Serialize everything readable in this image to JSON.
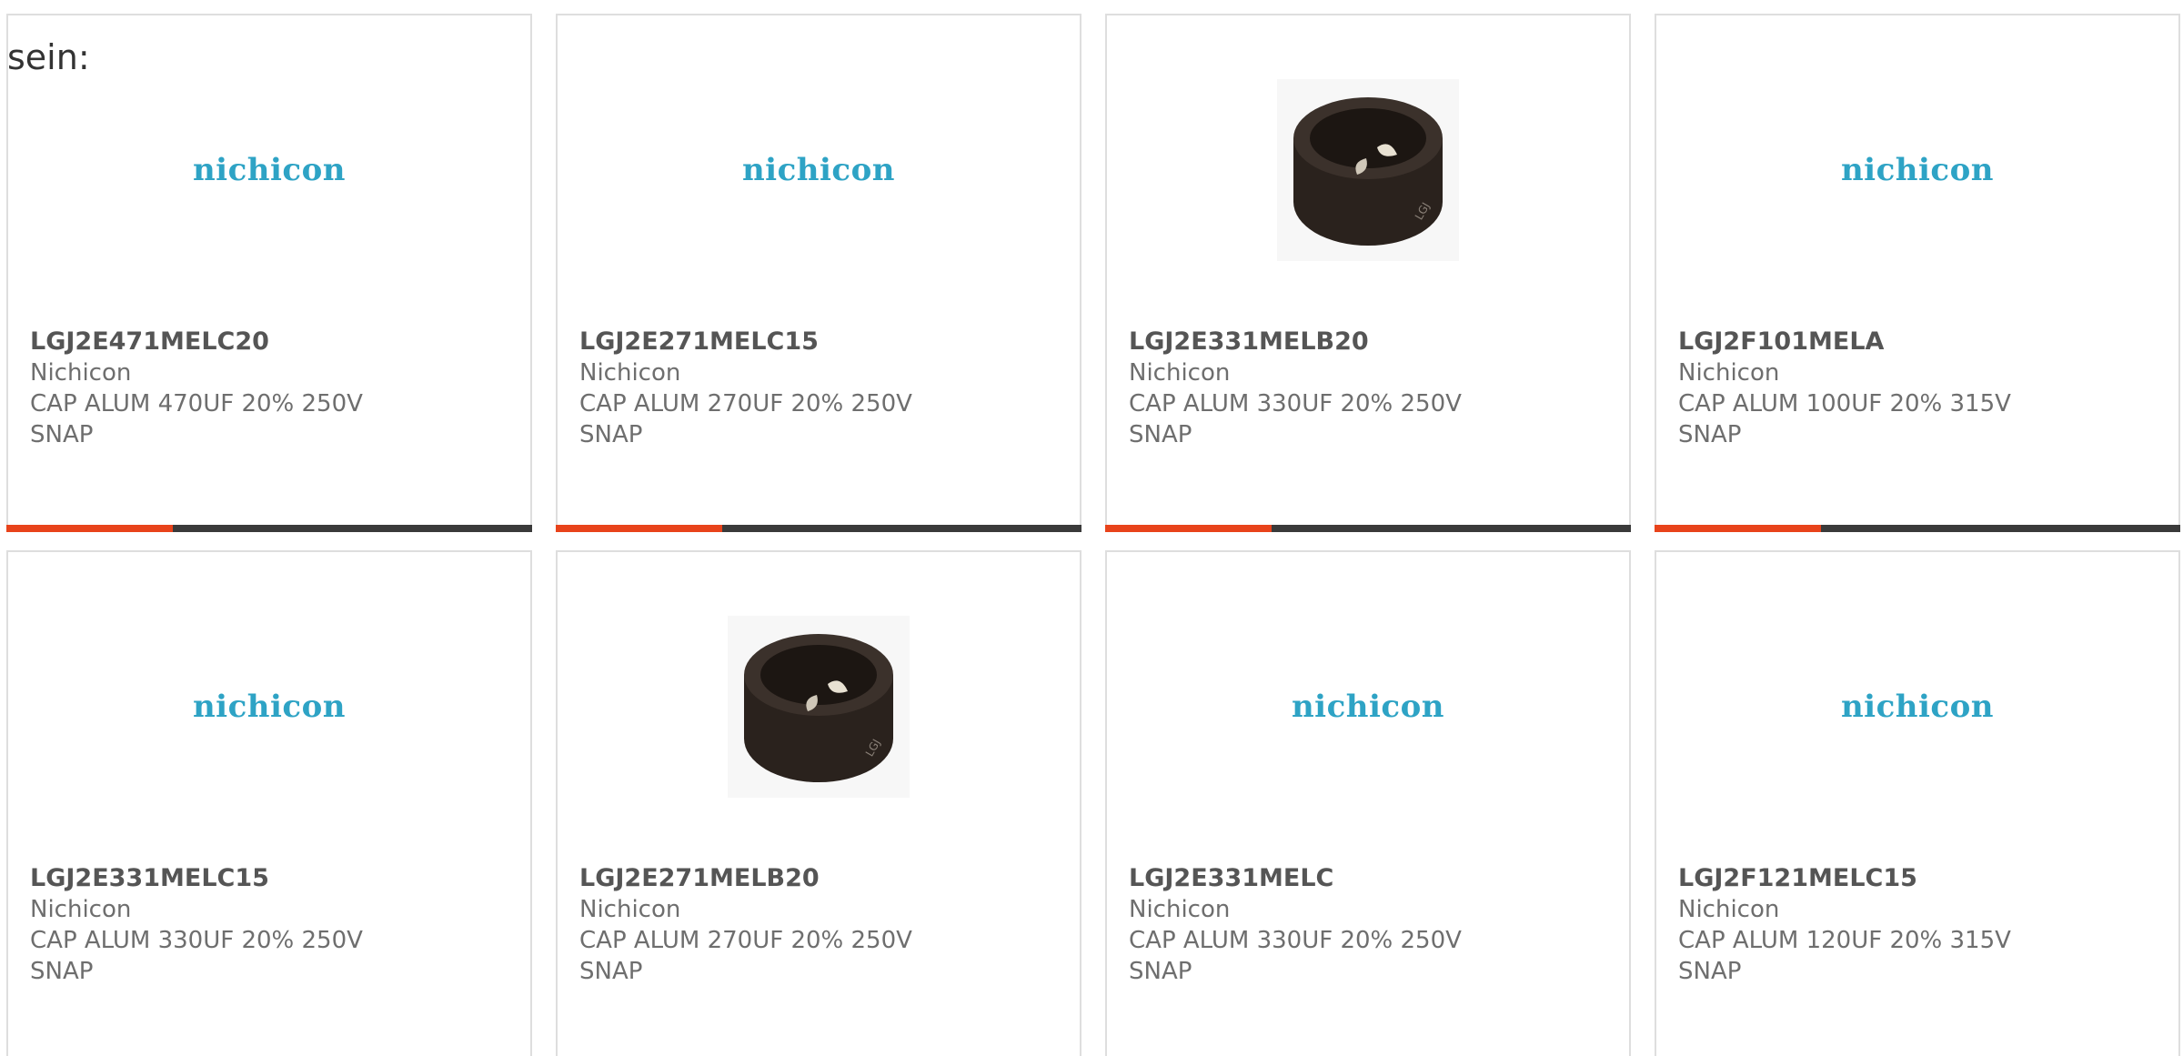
{
  "lead_text": "sein:",
  "colors": {
    "accent": "#e8431b",
    "bar": "#3a3a3a",
    "logo": "#2ea3c5"
  },
  "cards": [
    {
      "part": "LGJ2E471MELC20",
      "brand": "Nichicon",
      "desc": "CAP ALUM 470UF 20% 250V",
      "pkg": "SNAP",
      "image": "logo",
      "logo_text": "nichicon"
    },
    {
      "part": "LGJ2E271MELC15",
      "brand": "Nichicon",
      "desc": "CAP ALUM 270UF 20% 250V",
      "pkg": "SNAP",
      "image": "logo",
      "logo_text": "nichicon"
    },
    {
      "part": "LGJ2E331MELB20",
      "brand": "Nichicon",
      "desc": "CAP ALUM 330UF 20% 250V",
      "pkg": "SNAP",
      "image": "capacitor-photo",
      "logo_text": ""
    },
    {
      "part": "LGJ2F101MELA",
      "brand": "Nichicon",
      "desc": "CAP ALUM 100UF 20% 315V",
      "pkg": "SNAP",
      "image": "logo",
      "logo_text": "nichicon"
    },
    {
      "part": "LGJ2E331MELC15",
      "brand": "Nichicon",
      "desc": "CAP ALUM 330UF 20% 250V",
      "pkg": "SNAP",
      "image": "logo",
      "logo_text": "nichicon"
    },
    {
      "part": "LGJ2E271MELB20",
      "brand": "Nichicon",
      "desc": "CAP ALUM 270UF 20% 250V",
      "pkg": "SNAP",
      "image": "capacitor-photo",
      "logo_text": ""
    },
    {
      "part": "LGJ2E331MELC",
      "brand": "Nichicon",
      "desc": "CAP ALUM 330UF 20% 250V",
      "pkg": "SNAP",
      "image": "logo",
      "logo_text": "nichicon"
    },
    {
      "part": "LGJ2F121MELC15",
      "brand": "Nichicon",
      "desc": "CAP ALUM 120UF 20% 315V",
      "pkg": "SNAP",
      "image": "logo",
      "logo_text": "nichicon"
    }
  ]
}
